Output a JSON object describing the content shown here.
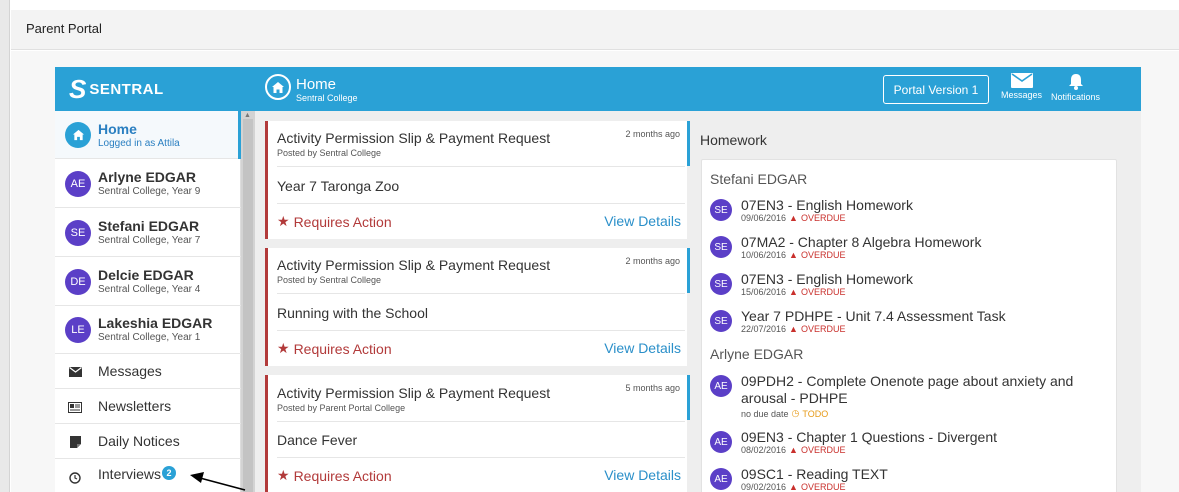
{
  "portal": {
    "title": "Parent Portal"
  },
  "header": {
    "logo_text": "SENTRAL",
    "title": "Home",
    "subtitle": "Sentral College",
    "portal_button": "Portal Version 1",
    "messages_label": "Messages",
    "notifications_label": "Notifications",
    "accent_color": "#2aa1d6"
  },
  "sidebar": {
    "home": {
      "name": "Home",
      "sub": "Logged in as Attila"
    },
    "students": [
      {
        "initials": "AE",
        "name": "Arlyne EDGAR",
        "sub": "Sentral College, Year 9"
      },
      {
        "initials": "SE",
        "name": "Stefani EDGAR",
        "sub": "Sentral College, Year 7"
      },
      {
        "initials": "DE",
        "name": "Delcie EDGAR",
        "sub": "Sentral College, Year 4"
      },
      {
        "initials": "LE",
        "name": "Lakeshia EDGAR",
        "sub": "Sentral College, Year 1"
      }
    ],
    "links": [
      {
        "label": "Messages",
        "icon": "envelope-icon"
      },
      {
        "label": "Newsletters",
        "icon": "newspaper-icon"
      },
      {
        "label": "Daily Notices",
        "icon": "note-icon"
      },
      {
        "label": "Interviews",
        "icon": "clock-icon",
        "badge": "2"
      }
    ]
  },
  "notices": [
    {
      "title": "Activity Permission Slip & Payment Request",
      "posted": "Posted by Sentral College",
      "time": "2 months ago",
      "event": "Year 7 Taronga Zoo",
      "action": "Requires Action",
      "link": "View Details"
    },
    {
      "title": "Activity Permission Slip & Payment Request",
      "posted": "Posted by Sentral College",
      "time": "2 months ago",
      "event": "Running with the School",
      "action": "Requires Action",
      "link": "View Details"
    },
    {
      "title": "Activity Permission Slip & Payment Request",
      "posted": "Posted by Parent Portal College",
      "time": "5 months ago",
      "event": "Dance Fever",
      "action": "Requires Action",
      "link": "View Details"
    }
  ],
  "homework": {
    "heading": "Homework",
    "groups": [
      {
        "student": "Stefani EDGAR",
        "items": [
          {
            "initials": "SE",
            "title": "07EN3 - English Homework",
            "date": "09/06/2016",
            "status": "OVERDUE"
          },
          {
            "initials": "SE",
            "title": "07MA2 - Chapter 8 Algebra Homework",
            "date": "10/06/2016",
            "status": "OVERDUE"
          },
          {
            "initials": "SE",
            "title": "07EN3 - English Homework",
            "date": "15/06/2016",
            "status": "OVERDUE"
          },
          {
            "initials": "SE",
            "title": "Year 7 PDHPE - Unit 7.4 Assessment Task",
            "date": "22/07/2016",
            "status": "OVERDUE"
          }
        ]
      },
      {
        "student": "Arlyne EDGAR",
        "items": [
          {
            "initials": "AE",
            "title": "09PDH2 - Complete Onenote page about anxiety and arousal - PDHPE",
            "date": "no due date",
            "status": "TODO"
          },
          {
            "initials": "AE",
            "title": "09EN3 - Chapter 1 Questions - Divergent",
            "date": "08/02/2016",
            "status": "OVERDUE"
          },
          {
            "initials": "AE",
            "title": "09SC1 - Reading TEXT",
            "date": "09/02/2016",
            "status": "OVERDUE"
          }
        ]
      }
    ]
  }
}
